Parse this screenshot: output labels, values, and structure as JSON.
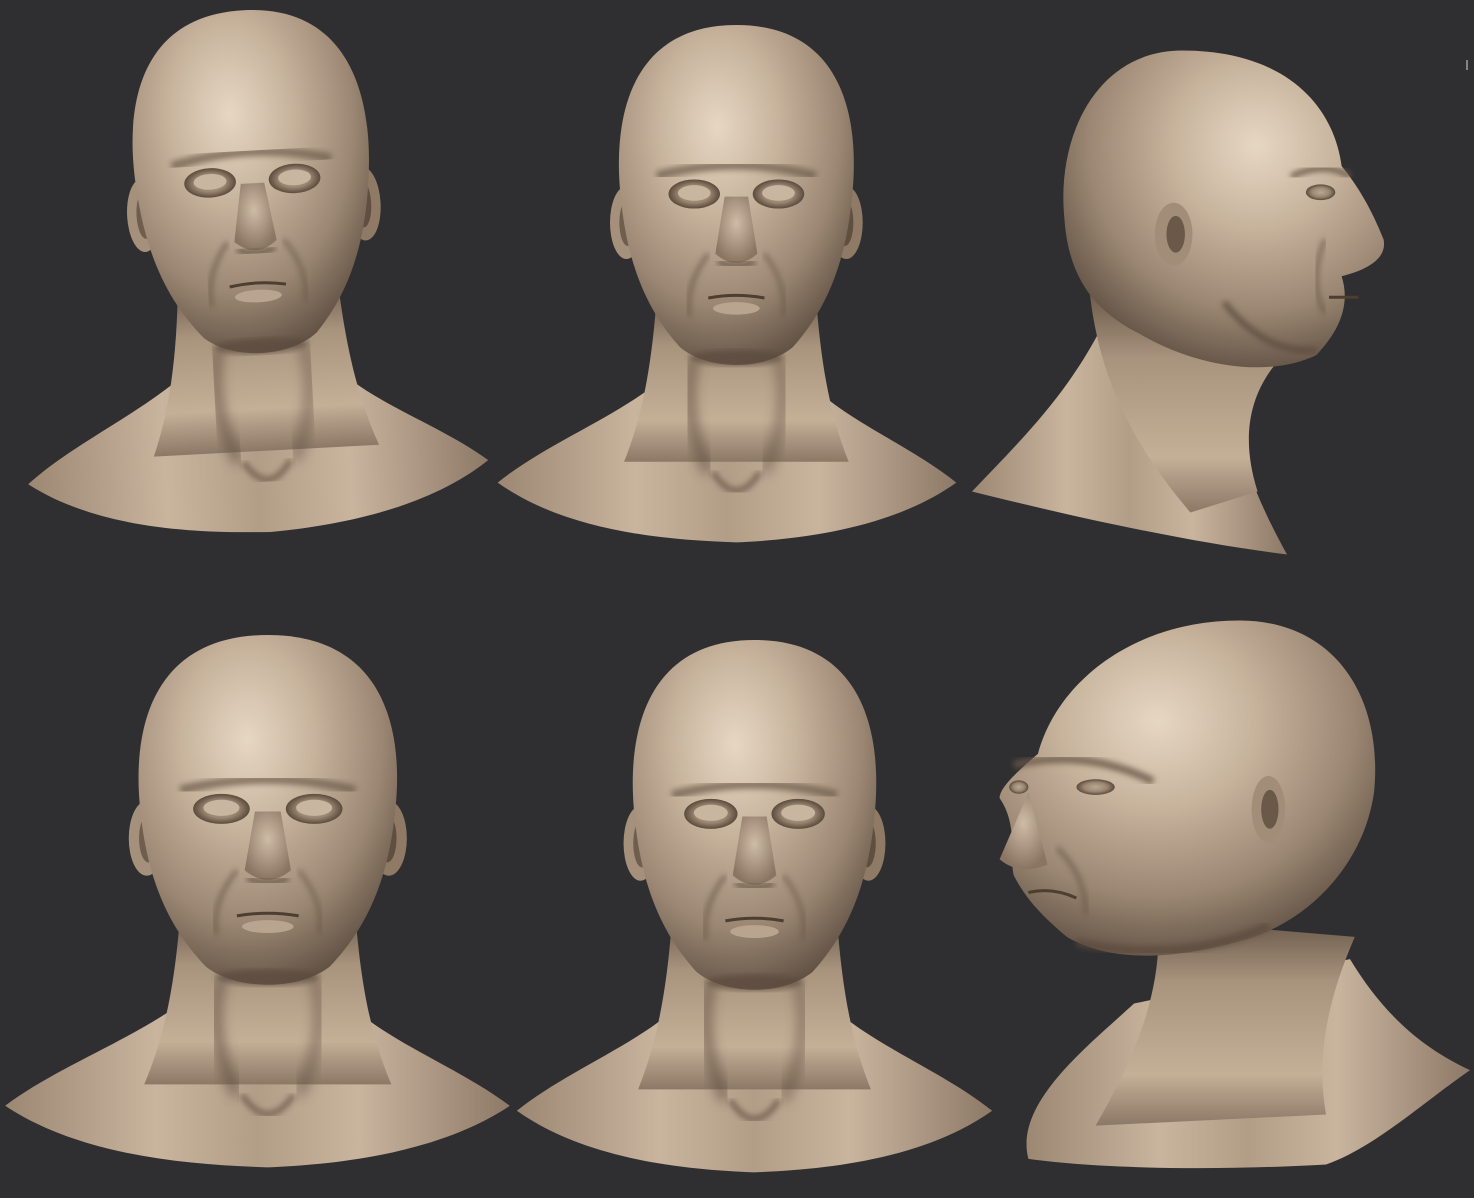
{
  "colors": {
    "background": "#2f2f31",
    "clay_base": "#a99580",
    "clay_light": "#cdbba5",
    "clay_highlight": "#e2d3bf",
    "clay_shadow": "#5e4f41",
    "clay_deep": "#3e332a"
  },
  "views": [
    {
      "id": "front-left-upper",
      "pose": "three-quarter-left",
      "facing": "left"
    },
    {
      "id": "front-center-upper",
      "pose": "front",
      "facing": "center"
    },
    {
      "id": "profile-right-upper",
      "pose": "profile",
      "facing": "right"
    },
    {
      "id": "front-left-lower",
      "pose": "front-low-angle",
      "facing": "left"
    },
    {
      "id": "front-center-lower",
      "pose": "front-down",
      "facing": "center"
    },
    {
      "id": "three-quarter-left-lower",
      "pose": "three-quarter",
      "facing": "left"
    }
  ]
}
